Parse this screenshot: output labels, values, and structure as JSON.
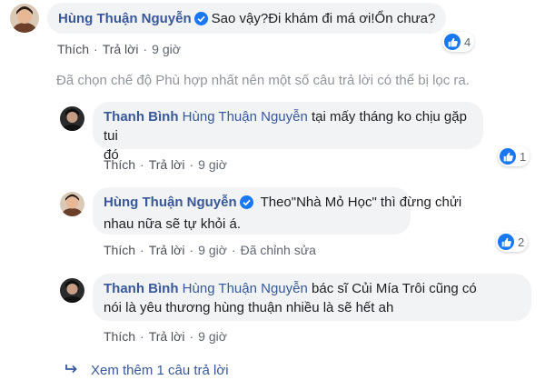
{
  "comments": [
    {
      "author": "Hùng Thuận Nguyễn",
      "text": "Sao vậy?Đi khám đi má ơi!Ổn chưa?",
      "reactions": "4",
      "like": "Thích",
      "reply": "Trả lời",
      "time": "9 giờ"
    }
  ],
  "notice": "Đã chọn chế độ Phù hợp nhất nên một số câu trả lời có thể bị lọc ra.",
  "replies": [
    {
      "author": "Thanh Bình",
      "mention": "Hùng Thuận Nguyễn",
      "line1": " tại mấy tháng ko chịu gặp tui",
      "line2": "đó",
      "reactions": "1",
      "like": "Thích",
      "reply": "Trả lời",
      "time": "9 giờ"
    },
    {
      "author": "Hùng Thuận Nguyễn",
      "line1": "Theo\"Nhà Mỏ Học\" thì đừng chửi",
      "line2": "nhau nữa sẽ tự khỏi á.",
      "reactions": "2",
      "like": "Thích",
      "reply": "Trả lời",
      "time": "9 giờ",
      "edited": "Đã chỉnh sửa"
    },
    {
      "author": "Thanh Bình",
      "mention": "Hùng Thuận Nguyễn",
      "line1": " bác sĩ Củi Mía Trôi cũng có",
      "line2": "nói là yêu thương hùng thuận nhiều là sẽ hết ah",
      "like": "Thích",
      "reply": "Trả lời",
      "time": "9 giờ"
    }
  ],
  "see_more": "Xem thêm 1 câu trả lời",
  "icons": {
    "like": "like-icon",
    "verified": "verified-icon",
    "reply_arrow": "reply-arrow-icon"
  },
  "colors": {
    "name": "#385898",
    "bubble": "#f2f3f5",
    "like_blue": "#1877f2",
    "meta": "#606770"
  }
}
